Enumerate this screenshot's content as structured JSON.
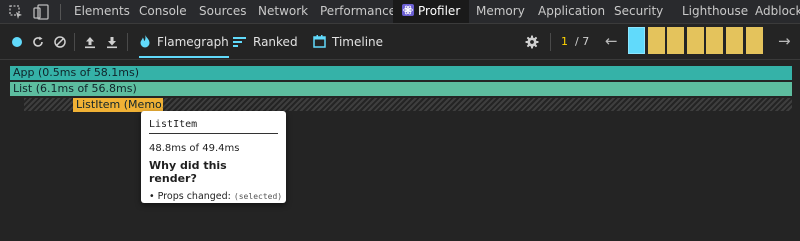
{
  "devtools_tabs": [
    {
      "label": "Elements"
    },
    {
      "label": "Console"
    },
    {
      "label": "Sources"
    },
    {
      "label": "Network"
    },
    {
      "label": "Performance"
    },
    {
      "label": "Profiler",
      "active": true
    },
    {
      "label": "Memory"
    },
    {
      "label": "Application"
    },
    {
      "label": "Security"
    },
    {
      "label": "Lighthouse"
    },
    {
      "label": "Adblock"
    }
  ],
  "profiler_toolbar": {
    "tabs": [
      {
        "label": "Flamegraph",
        "active": true
      },
      {
        "label": "Ranked"
      },
      {
        "label": "Timeline"
      }
    ],
    "commit_current": "1",
    "commit_total": "/ 7",
    "prev_arrow": "←",
    "next_arrow": "→",
    "selected_commit_index": 1,
    "commit_bar_count": 7
  },
  "flamegraph": {
    "rows": [
      {
        "label": "App (0.5ms of 58.1ms)",
        "color": "#35b2a8"
      },
      {
        "label": "List (6.1ms of 56.8ms)",
        "color": "#5dbd9f"
      },
      {
        "label": "ListItem (Memo...",
        "color": "#f0b135"
      }
    ]
  },
  "tooltip": {
    "title": "ListItem",
    "time": "48.8ms of 49.4ms",
    "why_heading": "Why did this render?",
    "reason_prefix": "• Props changed:",
    "reason_detail": "(selected)"
  },
  "colors": {
    "accent": "#61dafb",
    "commit_bar": "#e4c35c",
    "selected_commit": "#61dafb"
  }
}
